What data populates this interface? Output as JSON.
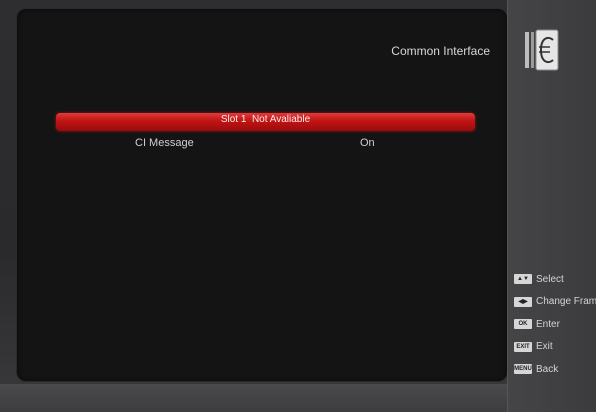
{
  "header": {
    "title": "Common Interface"
  },
  "menu": {
    "slot_label": "Slot 1  Not Avaliable",
    "ci_message_label": "CI Message",
    "ci_message_value": "On"
  },
  "legend": {
    "items": [
      {
        "key": "▲▼",
        "label": "Select"
      },
      {
        "key": "◀▶",
        "label": "Change Frame"
      },
      {
        "key": "OK",
        "label": "Enter"
      },
      {
        "key": "EXIT",
        "label": "Exit"
      },
      {
        "key": "MENU",
        "label": "Back"
      }
    ]
  },
  "colors": {
    "highlight": "#c41616",
    "panel": "#141414",
    "text": "#d0d0d0"
  }
}
